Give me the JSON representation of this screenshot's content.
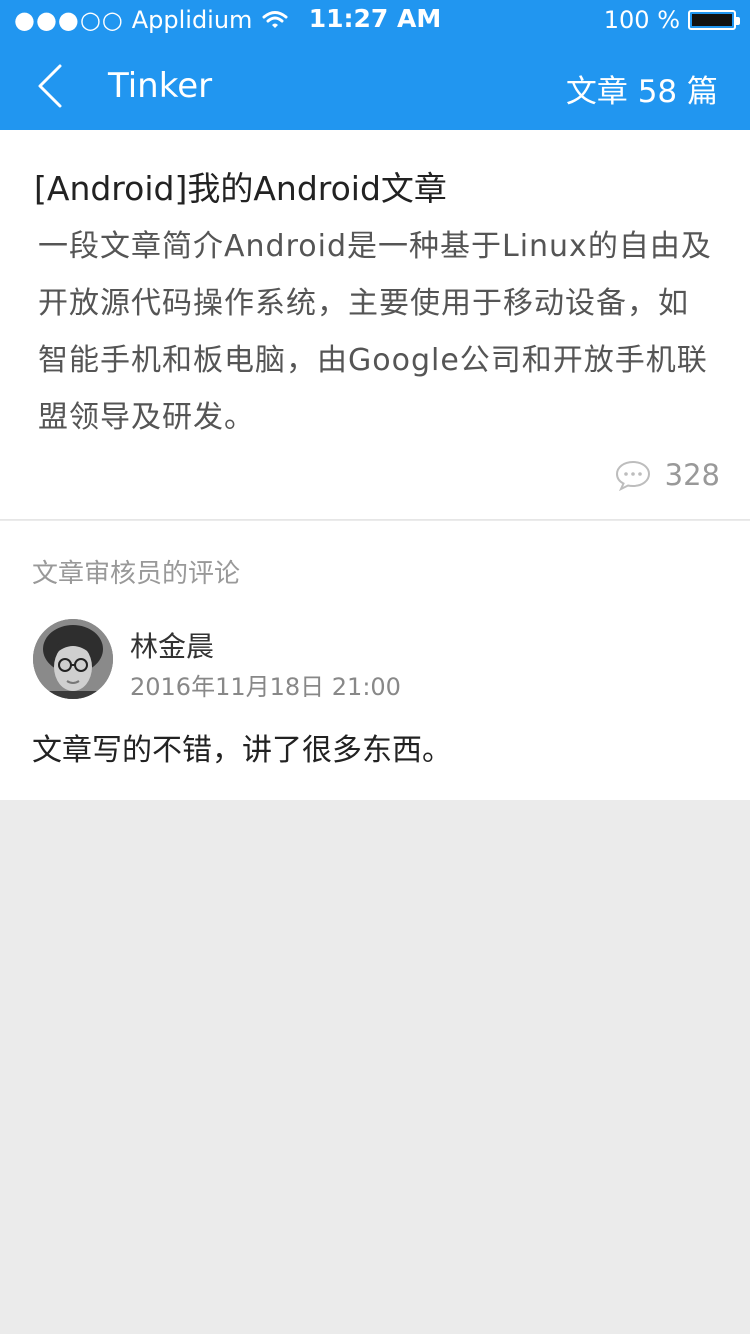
{
  "status_bar": {
    "signal": "●●●○○",
    "carrier": "Applidium",
    "time": "11:27 AM",
    "battery_text": "100 %",
    "battery_level": 1.0
  },
  "nav": {
    "back_icon": "chevron-left-icon",
    "title": "Tinker",
    "article_count": "文章 58 篇"
  },
  "article": {
    "title": "[Android]我的Android文章",
    "summary": "一段文章简介Android是一种基于Linux的自由及开放源代码操作系统，主要使用于移动设备，如智能手机和板电脑，由Google公司和开放手机联盟领导及研发。",
    "comment_icon": "speech-bubble-icon",
    "comment_count": "328"
  },
  "review": {
    "heading": "文章审核员的评论",
    "reviewer_name": "林金晨",
    "date": "2016年11月18日 21:00",
    "text": "文章写的不错，讲了很多东西。"
  },
  "colors": {
    "header_bg": "#2196f0",
    "page_bg": "#ebebeb"
  }
}
